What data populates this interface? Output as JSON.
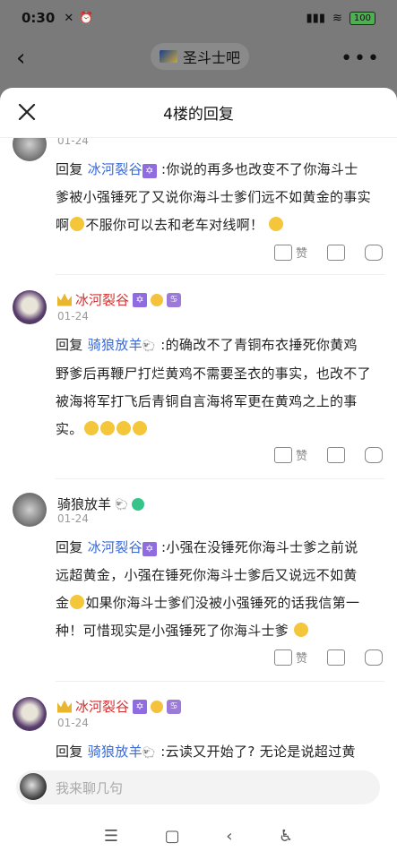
{
  "status": {
    "time": "0:30",
    "battery": "100"
  },
  "header": {
    "forum_name": "圣斗士吧"
  },
  "sheet": {
    "title": "4楼的回复"
  },
  "replies": [
    {
      "date": "01-24",
      "lines": [
        [
          "回复 ",
          "@冰河裂谷",
          " :你说的再多也改变不了你海斗士"
        ],
        [
          "爹被小强锤死了又说你海斗士爹们远不如黄金的事实"
        ],
        [
          "啊",
          "emoji",
          "不服你可以去和老车对线啊！",
          "emoji"
        ]
      ],
      "mention": "冰河裂谷",
      "line1": ":你说的再多也改变不了你海斗士",
      "line2": "爹被小强锤死了又说你海斗士爹们远不如黄金的事实",
      "line3a": "啊",
      "line3b": "不服你可以去和老车对线啊！",
      "like_label": "赞"
    },
    {
      "name": "冰河裂谷",
      "date": "01-24",
      "mention": "骑狼放羊",
      "line1": ":的确改不了青铜布衣捶死你黄鸡",
      "line2": "野爹后再鞭尸打烂黄鸡不需要圣衣的事实，也改不了",
      "line3": "被海将军打飞后青铜自言海将军更在黄鸡之上的事",
      "line4": "实。",
      "like_label": "赞"
    },
    {
      "name": "骑狼放羊",
      "date": "01-24",
      "mention": "冰河裂谷",
      "line1": ":小强在没锤死你海斗士爹之前说",
      "line2": "远超黄金，小强在锤死你海斗士爹后又说远不如黄",
      "line3": "金",
      "line3b": "如果你海斗士爹们没被小强锤死的话我信第一",
      "line4": "种！可惜现实是小强锤死了你海斗士爹",
      "like_label": "赞"
    },
    {
      "name": "冰河裂谷",
      "date": "01-24",
      "mention": "骑狼放羊",
      "line1": ":云读又开始了? 无论是说超过黄"
    }
  ],
  "reply_prefix": "回复",
  "input": {
    "placeholder": "我来聊几句"
  }
}
